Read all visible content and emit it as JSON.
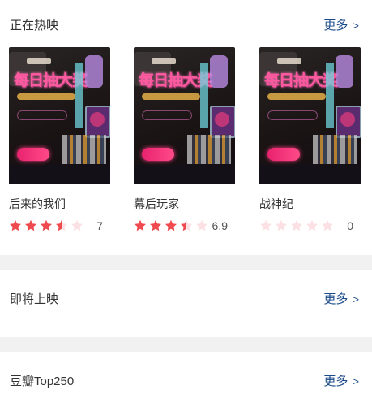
{
  "now_showing": {
    "title": "正在热映",
    "more_label": "更多",
    "movies": [
      {
        "name": "后来的我们",
        "rating_stars": 3.5,
        "score": "7"
      },
      {
        "name": "幕后玩家",
        "rating_stars": 3.5,
        "score": "6.9"
      },
      {
        "name": "战神纪",
        "rating_stars": 0,
        "score": "0"
      }
    ],
    "poster_text": "每日抽大奖"
  },
  "coming_soon": {
    "title": "即将上映",
    "more_label": "更多"
  },
  "top250": {
    "title": "豆瓣Top250",
    "more_label": "更多"
  },
  "colors": {
    "star_filled": "#ef4a4f",
    "star_empty": "#fbe1e3",
    "more_link": "#1a4a8a",
    "divider": "#f1f1f1"
  }
}
